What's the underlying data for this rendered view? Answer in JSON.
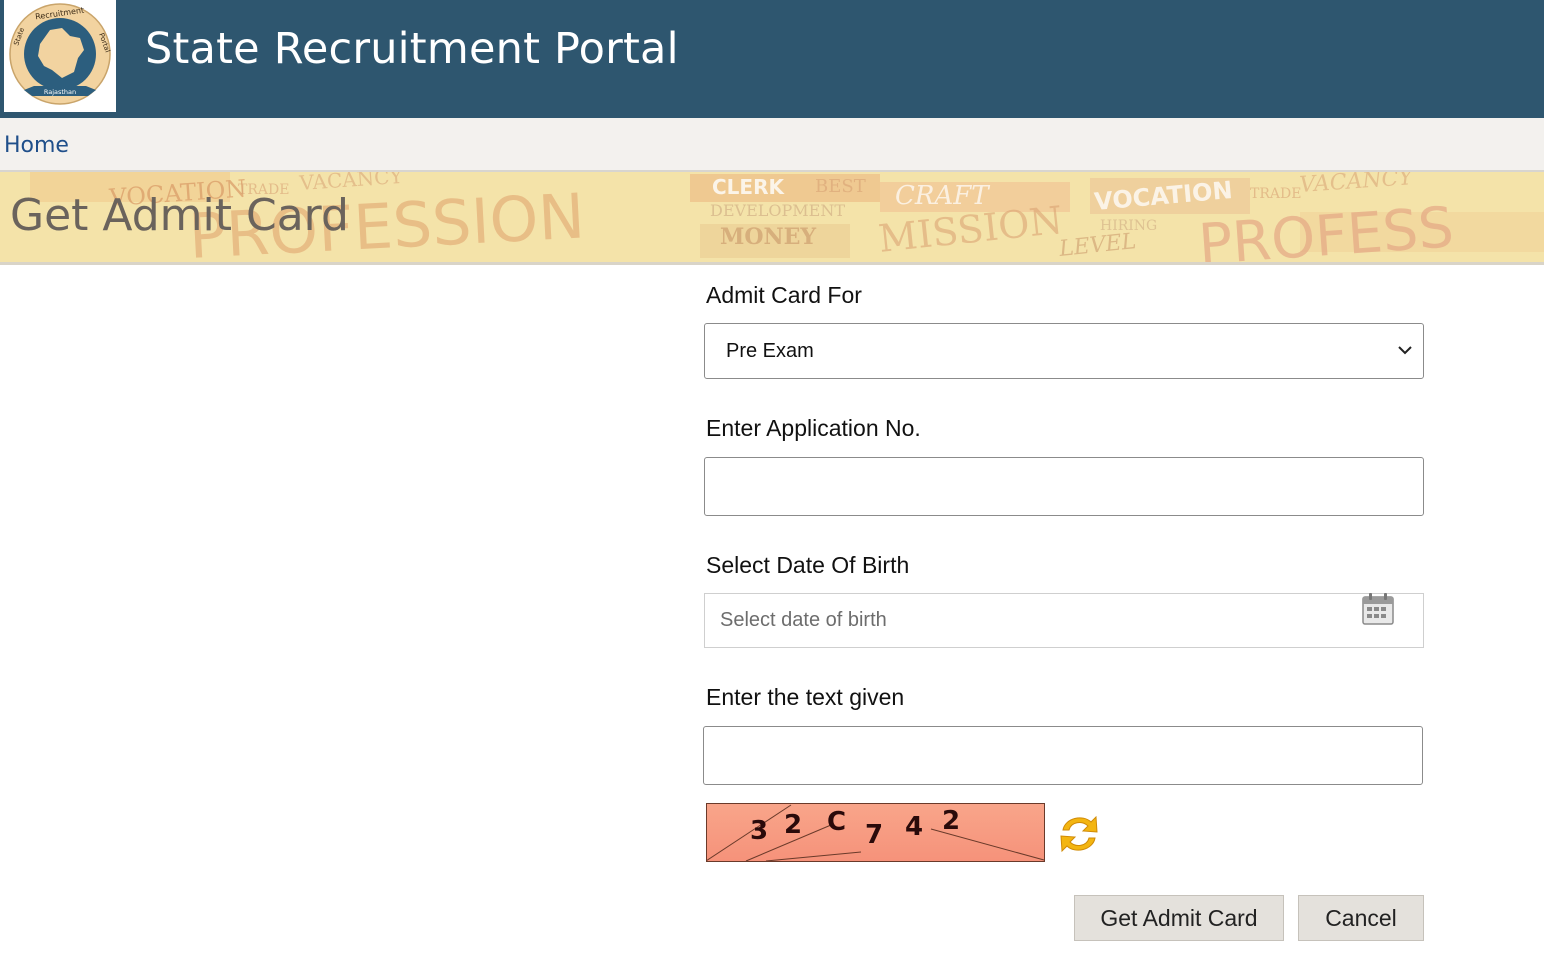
{
  "header": {
    "site_title": "State Recruitment Portal",
    "logo": {
      "icon": "state-emblem-icon",
      "top_text": "Recruitment",
      "left_text": "State",
      "right_text": "Portal",
      "ribbon_text": "Rajasthan"
    }
  },
  "breadcrumb": {
    "home_label": "Home"
  },
  "banner": {
    "title": "Get Admit Card",
    "background_words": [
      "PROFESSION",
      "VOCATION",
      "TRADE",
      "VACANCY",
      "CLERK",
      "BEST",
      "DEVELOPMENT",
      "MONEY",
      "CRAFT",
      "MISSION",
      "VOCATION",
      "TRADE",
      "VACANCY",
      "HIRING",
      "LEVEL",
      "PROFESS"
    ]
  },
  "form": {
    "admit_card_for": {
      "label": "Admit Card For",
      "selected": "Pre Exam",
      "icon": "chevron-down-icon"
    },
    "application_no": {
      "label": "Enter Application No.",
      "value": "",
      "placeholder": ""
    },
    "dob": {
      "label": "Select Date Of Birth",
      "value": "",
      "placeholder": "Select date of birth",
      "icon": "calendar-icon"
    },
    "captcha": {
      "label": "Enter the text given",
      "value": "",
      "placeholder": "",
      "image_text": [
        "3",
        "2",
        "C",
        "7",
        "4",
        "2"
      ],
      "refresh_icon": "refresh-icon"
    },
    "buttons": {
      "submit_label": "Get Admit Card",
      "cancel_label": "Cancel"
    }
  },
  "colors": {
    "header_bg": "#2e566f",
    "banner_bg": "#f4e3a9",
    "captcha_bg": "#f79a7a",
    "link": "#1f4f8a",
    "button_bg": "#e4e1dc"
  }
}
